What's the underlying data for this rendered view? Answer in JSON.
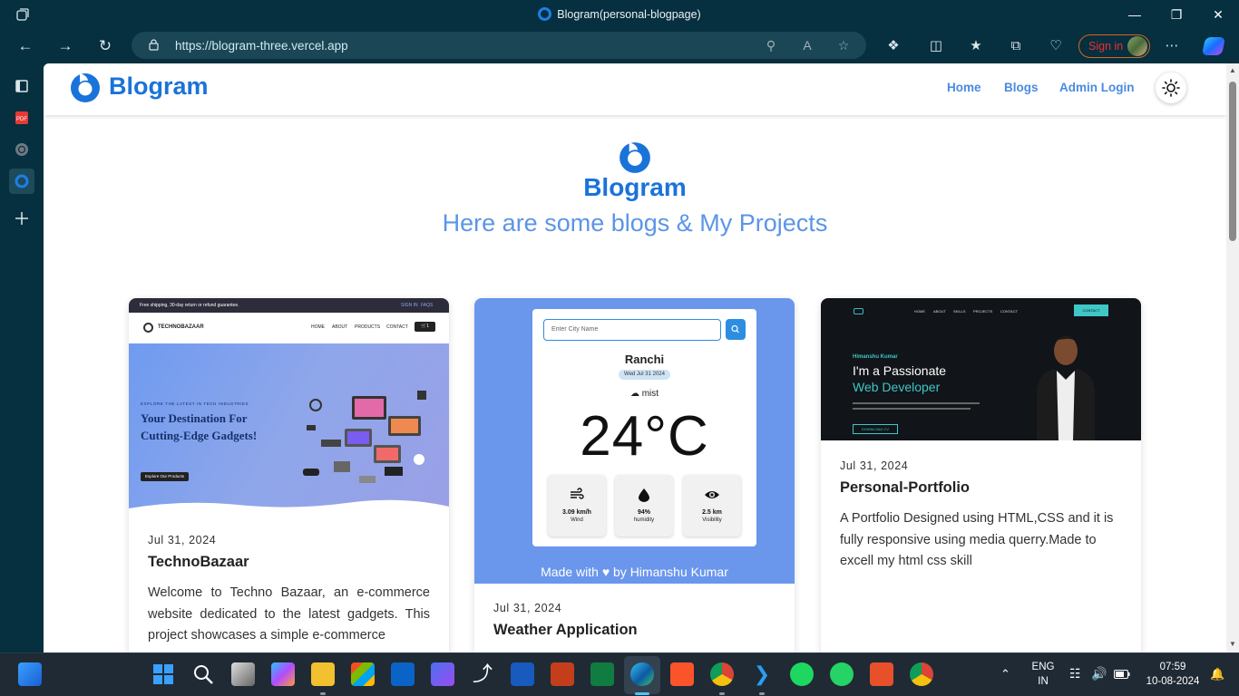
{
  "browser": {
    "tab_title": "Blogram(personal-blogpage)",
    "url": "https://blogram-three.vercel.app",
    "sign_in_label": "Sign in"
  },
  "site": {
    "logo_text": "Blogram",
    "nav": [
      "Home",
      "Blogs",
      "Admin Login"
    ],
    "hero_title": "Blogram",
    "hero_subtitle": "Here are some blogs & My Projects"
  },
  "cards": [
    {
      "date": "Jul 31, 2024",
      "title": "TechnoBazaar",
      "description": "Welcome to Techno Bazaar, an e-commerce website dedicated to the latest gadgets. This project showcases a simple e-commerce",
      "preview": {
        "topbar": "Free shipping, 30-day return or refund guarantee.",
        "topbar_links": [
          "SIGN IN",
          "FAQS"
        ],
        "brand": "TECHNOBAZAAR",
        "menu": [
          "HOME",
          "ABOUT",
          "PRODUCTS",
          "CONTACT"
        ],
        "cart": "1",
        "kicker": "EXPLORE THE LATEST IN TECH INDUSTRIES",
        "headline": "Your Destination For Cutting-Edge Gadgets!",
        "cta": "Explore Our Products"
      }
    },
    {
      "date": "Jul 31, 2024",
      "title": "Weather Application",
      "preview": {
        "search_placeholder": "Enter City Name",
        "city": "Ranchi",
        "date": "Wed Jul 31 2024",
        "condition": "mist",
        "temperature": "24°C",
        "stats": [
          {
            "value": "3.09 km/h",
            "label": "Wind",
            "icon": "wind-icon"
          },
          {
            "value": "94%",
            "label": "humidity",
            "icon": "drop-icon"
          },
          {
            "value": "2.5 km",
            "label": "Visibility",
            "icon": "eye-icon"
          }
        ],
        "footer": "Made with ♥ by Himanshu Kumar"
      }
    },
    {
      "date": "Jul 31, 2024",
      "title": "Personal-Portfolio",
      "description": "A Portfolio Designed using  HTML,CSS and it is fully responsive using media querry.Made to excell my html css skill",
      "preview": {
        "menu": [
          "HOME",
          "ABOUT",
          "SKILLS",
          "PROJECTS",
          "CONTACT"
        ],
        "contact_btn": "CONTACT",
        "name": "Himanshu Kumar",
        "line1": "I'm a Passionate",
        "line2": "Web Developer",
        "cta": "DOWNLOAD CV"
      }
    }
  ],
  "taskbar": {
    "language": "ENG",
    "region": "IN",
    "time": "07:59",
    "date": "10-08-2024"
  },
  "colors": {
    "chrome": "#062f3f",
    "brand_blue": "#1a73d9",
    "link_blue": "#4a8ae0",
    "weather_bg": "#6a96ec"
  }
}
